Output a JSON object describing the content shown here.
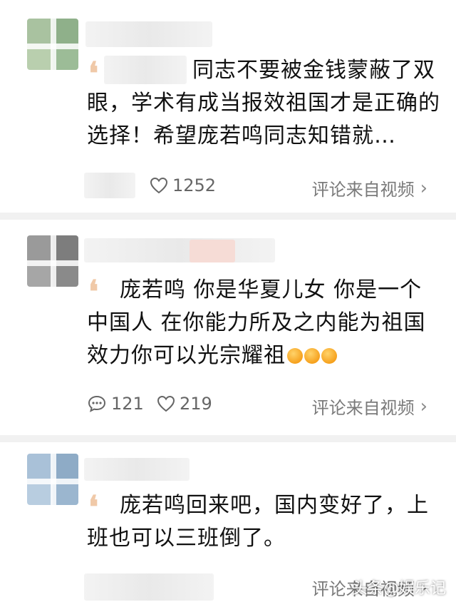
{
  "comments": [
    {
      "text": "同志不要被金钱蒙蔽了双眼，学术有成当报效祖国才是正确的选择！希望庞若鸣同志知错就…",
      "likes": "1252",
      "replies": "",
      "source": "评论来自视频",
      "avatar_colors": [
        "#a9c2a0",
        "#8fb08a",
        "#b9cfae",
        "#9cbc97"
      ]
    },
    {
      "text": "庞若鸣 你是华夏儿女 你是一个中国人 在你能力所及之内能为祖国效力你可以光宗耀祖",
      "likes": "219",
      "replies": "121",
      "source": "评论来自视频",
      "avatar_colors": [
        "#9a9a9a",
        "#7d7d7d",
        "#a6a6a6",
        "#8a8a8a"
      ]
    },
    {
      "text": "庞若鸣回来吧，国内变好了，上班也可以三班倒了。",
      "likes": "",
      "replies": "",
      "source": "评论来自视频",
      "avatar_colors": [
        "#a9c1d8",
        "#8eabc6",
        "#b8cde0",
        "#9bb6cf"
      ]
    }
  ],
  "icons": {
    "like": "heart-icon",
    "reply": "comment-bubble-icon",
    "chevron": "chevron-right-icon"
  },
  "watermark": {
    "text": "头条@娱乐记"
  }
}
